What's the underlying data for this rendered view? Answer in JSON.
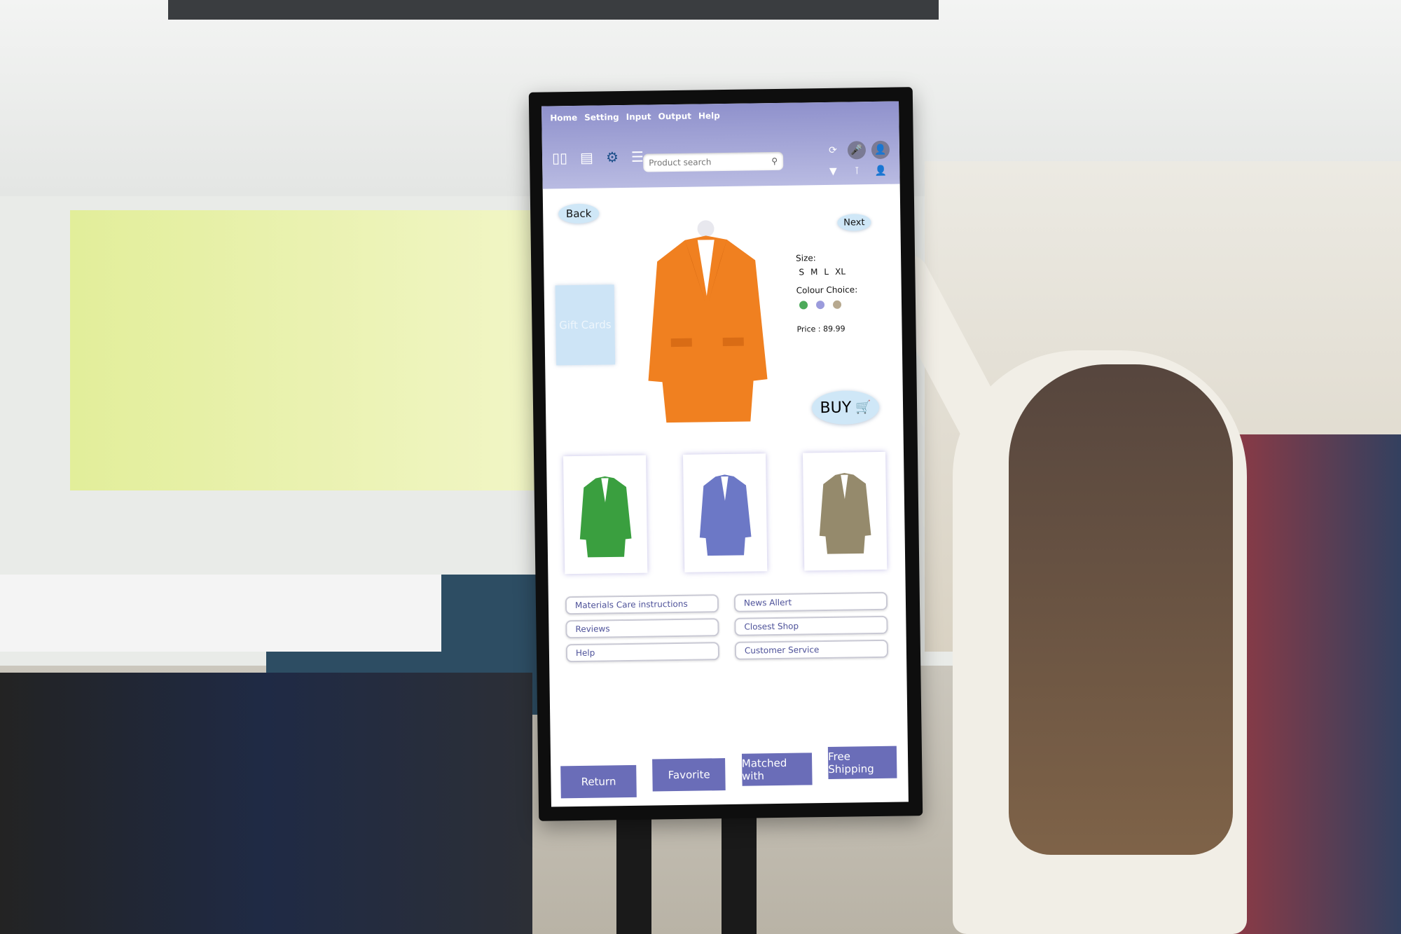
{
  "menu": [
    "Home",
    "Setting",
    "Input",
    "Output",
    "Help"
  ],
  "toolbar": {
    "icons": [
      "book-icon",
      "document-icon",
      "gear-icon",
      "hamburger-menu-icon"
    ],
    "search_placeholder": "Product search",
    "search_icon": "search-icon",
    "right_icons": [
      "refresh-icon",
      "microphone-icon",
      "add-user-icon",
      "dropdown-triangle-icon",
      "shirt-icon",
      "user-icon"
    ]
  },
  "nav": {
    "back": "Back",
    "next": "Next"
  },
  "gift_cards": "Gift Cards",
  "product": {
    "size_label": "Size:",
    "sizes": [
      "S",
      "M",
      "L",
      "XL"
    ],
    "colour_label": "Colour Choice:",
    "colours": [
      "#4caa5a",
      "#9b9bdc",
      "#b7a98f"
    ],
    "price_label": "Price",
    "price": "89.99",
    "buy_label": "BUY",
    "main_colour": "#f08020"
  },
  "variants": [
    {
      "name": "green",
      "colour": "#3a9f3f"
    },
    {
      "name": "blue",
      "colour": "#6c78c6"
    },
    {
      "name": "khaki",
      "colour": "#958a6c"
    }
  ],
  "links": {
    "left": [
      "Materials  Care instructions",
      "Reviews",
      "Help"
    ],
    "right": [
      "News  Allert",
      "Closest Shop",
      "Customer Service"
    ]
  },
  "bottom_buttons": [
    "Return",
    "Favorite",
    "Matched with",
    "Free Shipping"
  ],
  "colors": {
    "topbar": "#9fa1d6",
    "button": "#6a6db8",
    "pill": "#cfe7f7",
    "link_text": "#4d5199"
  }
}
